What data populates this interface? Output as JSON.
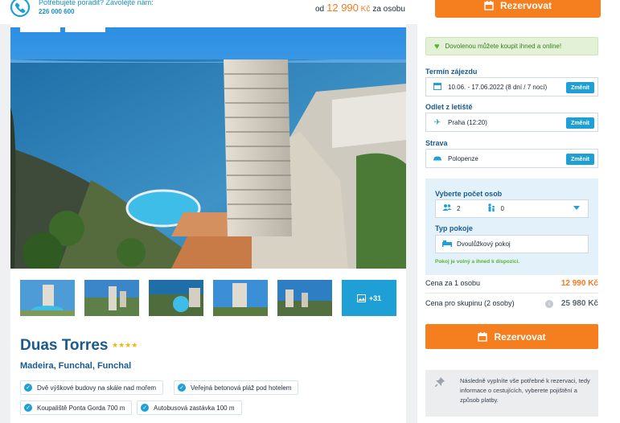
{
  "header": {
    "help_text": "Potřebujete poradit? Zavolejte nám:",
    "phone": "226 000 600",
    "price_prefix": "od",
    "price": "12 990",
    "currency": "Kč",
    "price_suffix": "za osobu",
    "reserve_label": "Rezervovat"
  },
  "gallery": {
    "more_label": "+31"
  },
  "hotel": {
    "name": "Duas Torres",
    "stars": "★★★★",
    "rating": 4,
    "location": "Madeira, Funchal, Funchal",
    "tags": [
      "Dvě výškové budovy na skále nad mořem",
      "Veřejná betonová pláž pod hotelem",
      "Koupaliště Ponta Gorda 700 m",
      "Autobusová zastávka 100 m"
    ]
  },
  "booking": {
    "online_note": "Dovolenou můžete koupit ihned a online!",
    "term_label": "Termín zájezdu",
    "term_value": "10.06. - 17.06.2022 (8 dní / 7 nocí)",
    "airport_label": "Odlet z letiště",
    "airport_value": "Praha (12:20)",
    "board_label": "Strava",
    "board_value": "Polopenze",
    "change_label": "Změnit",
    "persons_label": "Vyberte počet osob",
    "adults": "2",
    "children": "0",
    "room_label": "Typ pokoje",
    "room_value": "Dvoulůžkový pokoj",
    "room_available": "Pokoj je volný a ihned k dispozici.",
    "price_person_label": "Cena za 1 osobu",
    "price_person_value": "12 990 Kč",
    "price_group_label": "Cena pro skupinu (2 osoby)",
    "price_group_value": "25 980 Kč",
    "reserve_label": "Rezervovat",
    "note": "Následně vyplníte vše potřebné k rezervaci, tedy informace o cestujících, vyberete pojištění a způsob platby."
  },
  "colors": {
    "accent_orange": "#f57e1f",
    "accent_blue": "#1ea0d6",
    "title_blue": "#1a5a8f",
    "success_green": "#5cb130"
  }
}
